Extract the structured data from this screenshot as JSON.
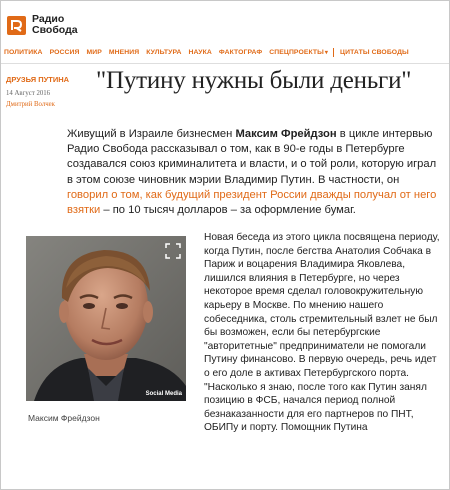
{
  "brand": {
    "name_line1": "Радио",
    "name_line2": "Свобода"
  },
  "nav": {
    "items": [
      "ПОЛИТИКА",
      "РОССИЯ",
      "МИР",
      "МНЕНИЯ",
      "КУЛЬТУРА",
      "НАУКА",
      "ФАКТОГРАФ",
      "СПЕЦПРОЕКТЫ",
      "ЦИТАТЫ СВОБОДЫ"
    ],
    "accent_color": "#e06a17"
  },
  "article": {
    "category": "ДРУЗЬЯ ПУТИНА",
    "date": "14 Август 2016",
    "author": "Дмитрий Волчек",
    "headline": "\"Путину нужны были деньги\"",
    "lead": {
      "part1": "Живущий в Израиле бизнесмен ",
      "name": "Максим Фрейдзон",
      "part2": " в цикле интервью Радио Свобода рассказывал о том, как в 90-е годы в Петербурге создавался союз криминалитета и власти, и о той роли, которую играл в этом союзе чиновник мэрии Владимир Путин. В частности, он ",
      "link": "говорил о том, как будущий президент России дважды получал от него взятки",
      "part3": " – по 10 тысяч долларов – за оформление бумаг."
    },
    "photo": {
      "credit": "Social Media",
      "caption": "Максим Фрейдзон"
    },
    "body": "Новая беседа из этого цикла посвящена периоду, когда Путин, после бегства Анатолия Собчака в Париж и воцарения Владимира Яковлева, лишился влияния в Петербурге, но через некоторое время сделал головокружительную карьеру в Москве. По мнению нашего собеседника, столь стремительный взлет не был бы возможен, если бы петербургские \"авторитетные\" предприниматели не помогали Путину финансово. В первую очередь, речь идет о его доле в активах Петербургского порта. \"Насколько я знаю, после того как Путин занял позицию в ФСБ, начался период полной безнаказанности для его партнеров по ПНТ, ОБИПу и порту. Помощник Путина"
  }
}
